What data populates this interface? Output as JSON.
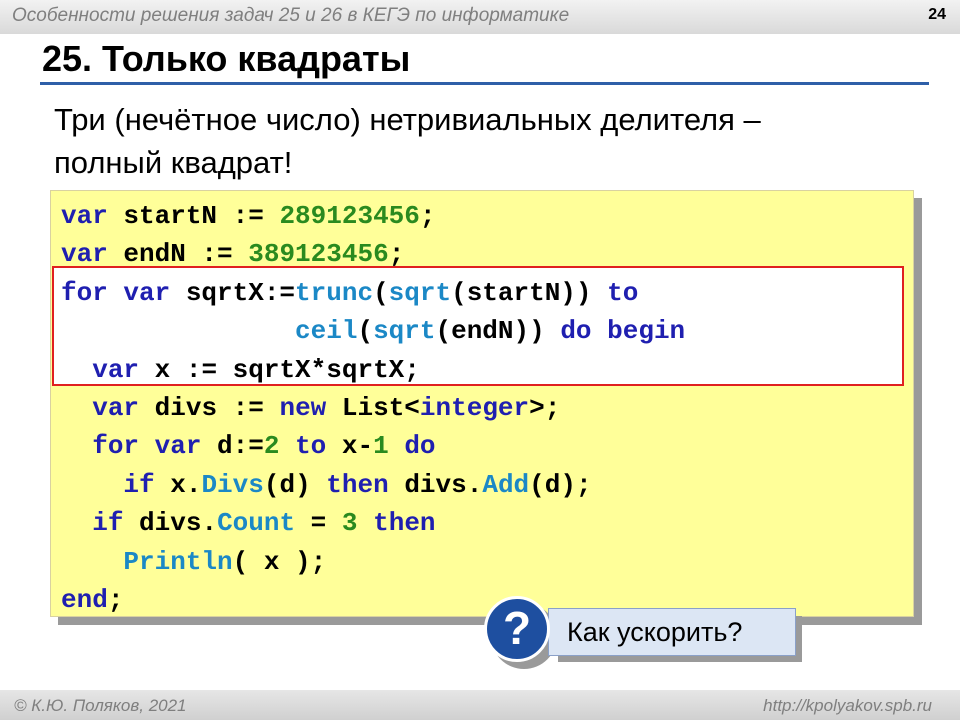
{
  "header": {
    "text": "Особенности решения задач 25 и 26 в КЕГЭ по информатике",
    "page_number": "24"
  },
  "title": "25. Только квадраты",
  "subtitle": {
    "line1": "Три (нечётное число) нетривиальных делителя –",
    "line2": "полный квадрат!"
  },
  "code": {
    "l1": {
      "k1": "var",
      "t1": " startN := ",
      "n1": "289123456",
      "t2": ";"
    },
    "l2": {
      "k1": "var",
      "t1": " endN := ",
      "n1": "389123456",
      "t2": ";"
    },
    "l3": {
      "k1": "for var",
      "t1": " sqrtX:=",
      "m1": "trunc",
      "t2": "(",
      "m2": "sqrt",
      "t3": "(startN)) ",
      "k2": "to"
    },
    "l4": {
      "m1": "ceil",
      "t1": "(",
      "m2": "sqrt",
      "t2": "(endN)) ",
      "k1": "do begin"
    },
    "l5": {
      "k1": "var",
      "t1": " x := sqrtX*sqrtX;"
    },
    "l6": {
      "k1": "var",
      "t1": " divs := ",
      "k2": "new",
      "t2": " List<",
      "k3": "integer",
      "t3": ">;"
    },
    "l7": {
      "k1": "for var",
      "t1": " d:=",
      "n1": "2",
      "t2": " ",
      "k2": "to",
      "t3": " x-",
      "n2": "1",
      "t4": " ",
      "k3": "do"
    },
    "l8": {
      "k1": "if",
      "t1": " x.",
      "m1": "Divs",
      "t2": "(d) ",
      "k2": "then",
      "t3": " divs.",
      "m2": "Add",
      "t4": "(d);"
    },
    "l9": {
      "k1": "if",
      "t1": " divs.",
      "m1": "Count",
      "t2": " = ",
      "n1": "3",
      "t3": " ",
      "k2": "then"
    },
    "l10": {
      "m1": "Println",
      "t1": "( x );"
    },
    "l11": {
      "k1": "end",
      "t1": ";"
    }
  },
  "badge": {
    "symbol": "?",
    "icon": "question-icon"
  },
  "callout": "Как ускорить?",
  "footer": {
    "left": "© К.Ю. Поляков, 2021",
    "right": "http://kpolyakov.spb.ru"
  },
  "colors": {
    "title_rule": "#2e5fa8",
    "code_bg": "#ffff99",
    "highlight_border": "#e02020",
    "badge": "#1e4fa0",
    "callout_bg": "#dce6f4"
  }
}
